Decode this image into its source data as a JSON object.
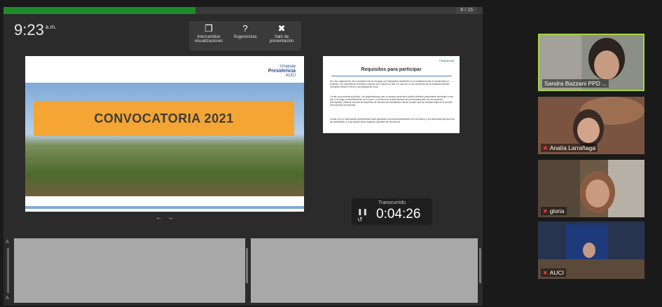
{
  "progress": {
    "fraction": 0.4,
    "counter": "6 / 15"
  },
  "clock": {
    "time": "9:23",
    "ampm": "a.m."
  },
  "toolbar": {
    "switch_views": "Intercambiar visualizaciones",
    "suggestions": "Sugerencias",
    "exit": "Salir de presentación"
  },
  "slide": {
    "logo_small": "Uruguay",
    "logo_main": "Presidencia",
    "logo_auci": "AUCI",
    "title": "CONVOCATORIA 2021"
  },
  "next_slide": {
    "title": "Requisitos para participar",
    "items": [
      "Ser una organización de la sociedad civil de Uruguay con integrantes residentes en la localidad donde se desarrollará el proyecto, con experiencia de trabajo conjunto de al menos un año. En caso de no ser residentes de la localidad deberán incorporar desde el inicio a una agrupación local.",
      "Contar con personería jurídica. Las organizaciones que no posean personería jurídica deberán presentarse asociadas a otra que sí la tenga, preferentemente de la zona. La Personería Jurídica deberá ser presentada junto con la propuesta (excluyente), además del Acta de Asamblea de elección de Autoridades, donde consten que las mismas están en el período de funciones (excluyente).",
      "Contar con un responsable administrativo para garantizar la buena administración de los fondos y una adecuada ejecución de las actividades, lo cual implica llevar registros contables de los mismos."
    ]
  },
  "timer": {
    "label": "Transcurrido",
    "value": "0:04:26"
  },
  "participants": [
    {
      "name": "Sandra Bazzani PPD ...",
      "muted": false,
      "active": true
    },
    {
      "name": "Analía Larrañaga",
      "muted": true,
      "active": false
    },
    {
      "name": "gloria",
      "muted": true,
      "active": false
    },
    {
      "name": "AUCI",
      "muted": true,
      "active": false
    }
  ],
  "colors": {
    "accent_green": "#1e8a2a",
    "active_border": "#a6d43a",
    "banner_orange": "#f4a534",
    "muted_red": "#e03a3a"
  }
}
